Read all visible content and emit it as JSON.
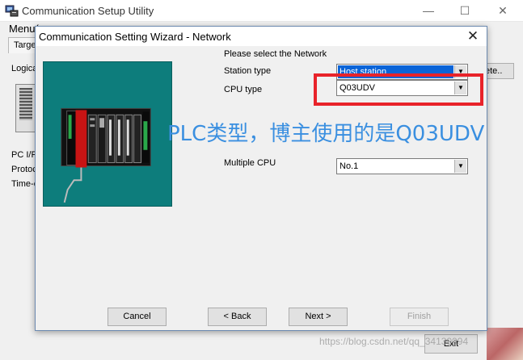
{
  "main_window": {
    "title": "Communication Setup Utility",
    "menu_label": "Menu(",
    "target_tab": "Targe",
    "left_labels": [
      "Logica",
      "PC I/F",
      "Protoc",
      "Time-c"
    ],
    "delete_label": "ete..",
    "exit_label": "Exit"
  },
  "dialog": {
    "title": "Communication Setting Wizard - Network",
    "prompt": "Please select the Network",
    "fields": {
      "station_type": {
        "label": "Station type",
        "value": "Host station"
      },
      "cpu_type": {
        "label": "CPU type",
        "value": "Q03UDV"
      },
      "multiple_cpu": {
        "label": "Multiple CPU",
        "value": "No.1"
      }
    },
    "buttons": {
      "cancel": "Cancel",
      "back": "< Back",
      "next": "Next >",
      "finish": "Finish"
    }
  },
  "annotation": {
    "text": "PLC类型，博主使用的是Q03UDV",
    "color": "#3a8fe0",
    "box_color": "#e8232a"
  },
  "watermark": "https://blog.csdn.net/qq_34139994",
  "colors": {
    "selection": "#0a64d8",
    "illustration_bg": "#0d7d7c"
  }
}
